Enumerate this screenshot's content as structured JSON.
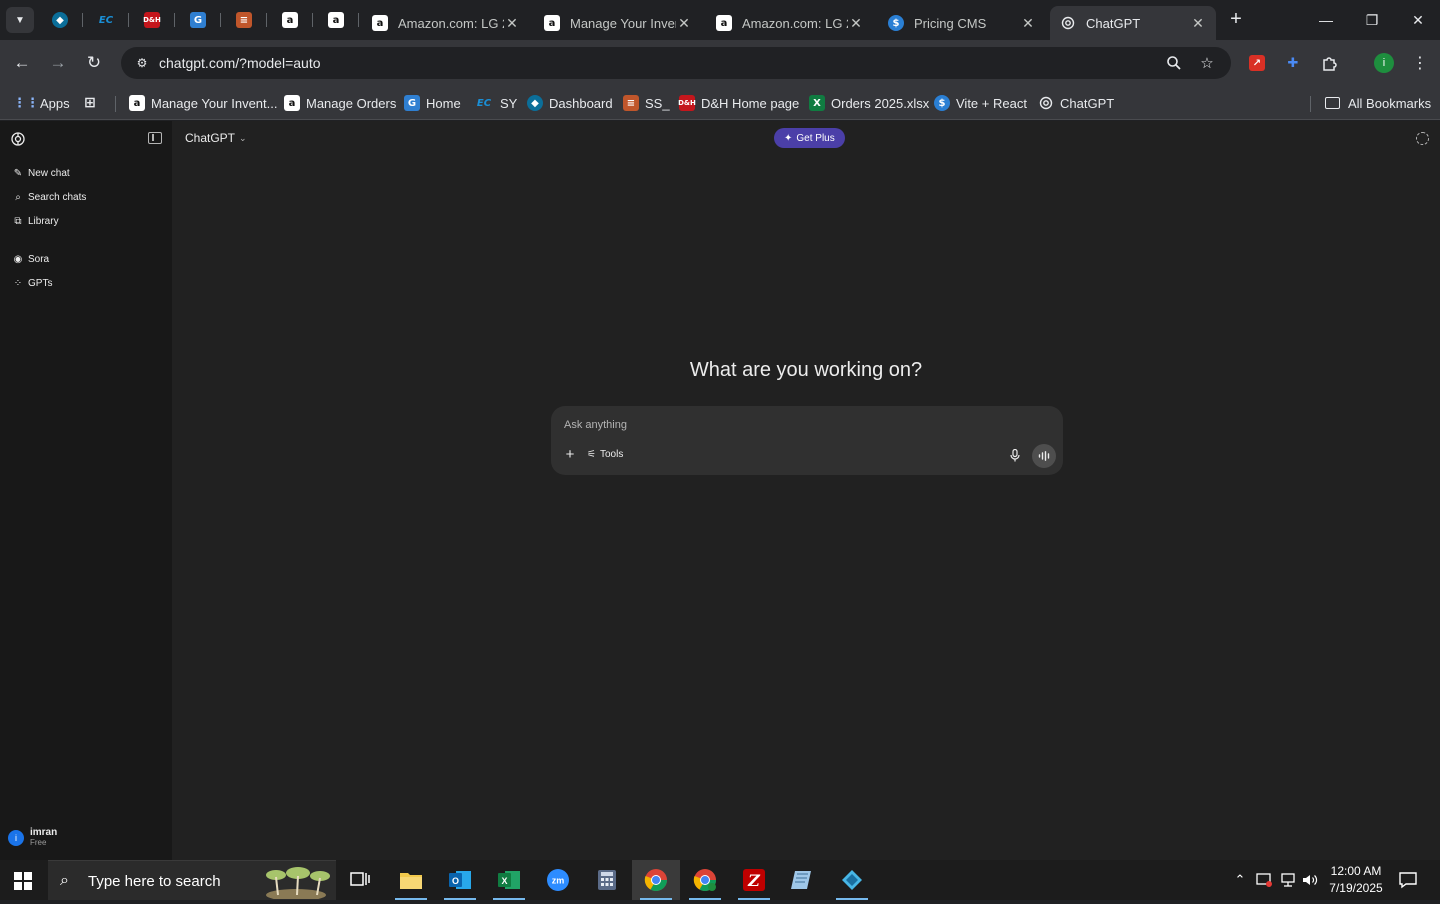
{
  "browser": {
    "tabs": [
      {
        "title": "Amazon.com: LG 2",
        "favicon": "amazon-icon"
      },
      {
        "title": "Manage Your Inven",
        "favicon": "amazon-icon"
      },
      {
        "title": "Amazon.com: LG 2",
        "favicon": "amazon-icon"
      },
      {
        "title": "Pricing CMS",
        "favicon": "dollar-icon"
      },
      {
        "title": "ChatGPT",
        "favicon": "openai-icon",
        "active": true
      }
    ],
    "url": "chatgpt.com/?model=auto",
    "bookmarks": [
      {
        "label": "Apps",
        "icon": "apps-grid-icon"
      },
      {
        "label": "Manage Your Invent...",
        "icon": "amazon-icon"
      },
      {
        "label": "Manage Orders",
        "icon": "amazon-icon"
      },
      {
        "label": "Home",
        "icon": "home-site-icon"
      },
      {
        "label": "SY",
        "icon": "ec-icon"
      },
      {
        "label": "Dashboard",
        "icon": "dashboard-icon"
      },
      {
        "label": "SS_",
        "icon": "ss-icon"
      },
      {
        "label": "D&H Home page",
        "icon": "dh-icon"
      },
      {
        "label": "Orders 2025.xlsx",
        "icon": "excel-icon"
      },
      {
        "label": "Vite + React",
        "icon": "dollar-icon"
      },
      {
        "label": "ChatGPT",
        "icon": "openai-icon"
      }
    ],
    "all_bookmarks": "All Bookmarks",
    "profile_initial": "i"
  },
  "sidebar": {
    "items": [
      {
        "label": "New chat",
        "icon": "new-chat-icon"
      },
      {
        "label": "Search chats",
        "icon": "search-icon"
      },
      {
        "label": "Library",
        "icon": "library-icon"
      },
      {
        "label": "Sora",
        "icon": "sora-icon"
      },
      {
        "label": "GPTs",
        "icon": "gpts-icon"
      }
    ],
    "user": {
      "initial": "i",
      "name": "imran",
      "plan": "Free"
    }
  },
  "main": {
    "model_label": "ChatGPT",
    "get_plus": "Get Plus",
    "headline": "What are you working on?",
    "composer": {
      "placeholder": "Ask anything",
      "tools_label": "Tools"
    }
  },
  "taskbar": {
    "search_placeholder": "Type here to search",
    "time": "12:00 AM",
    "date": "7/19/2025"
  },
  "colors": {
    "sidebar_bg": "#181818",
    "main_bg": "#212121",
    "composer_bg": "#303030",
    "get_plus_bg": "#4b3fa8",
    "browser_frame": "#35363a"
  }
}
